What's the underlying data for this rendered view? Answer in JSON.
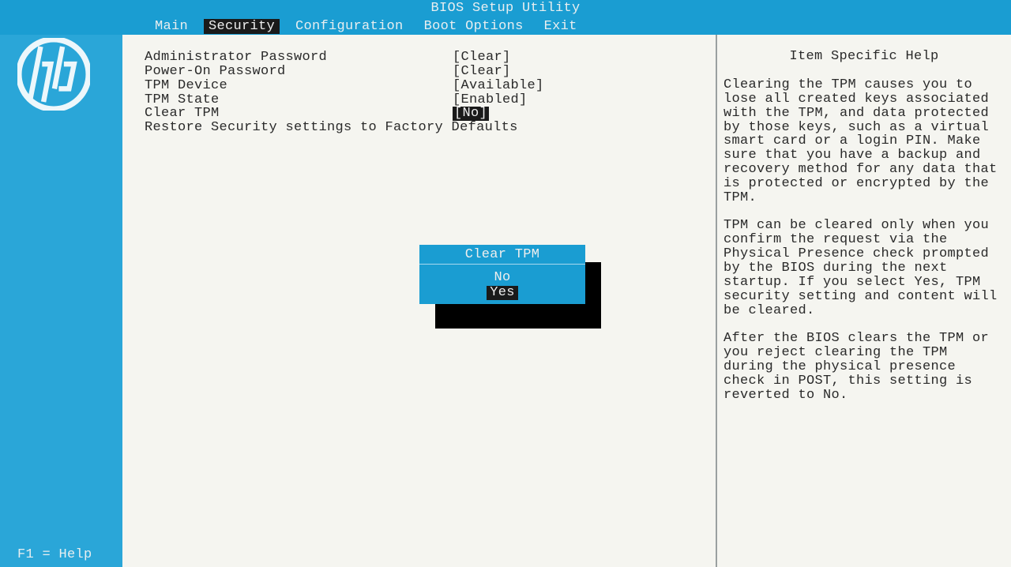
{
  "title": "BIOS Setup Utility",
  "menu": {
    "main": "Main",
    "security": "Security",
    "configuration": "Configuration",
    "boot_options": "Boot Options",
    "exit": "Exit"
  },
  "brand_text": "hp",
  "footer": "F1 = Help",
  "settings": {
    "admin_password": {
      "label": "Administrator Password",
      "value": "[Clear]"
    },
    "power_on_password": {
      "label": "Power-On Password",
      "value": "[Clear]"
    },
    "tpm_device": {
      "label": "TPM Device",
      "value": "[Available]"
    },
    "tpm_state": {
      "label": "TPM State",
      "value": "[Enabled]"
    },
    "clear_tpm": {
      "label": "Clear TPM",
      "value": "[No]"
    },
    "restore_defaults": {
      "label": "Restore Security settings to Factory Defaults"
    }
  },
  "dialog": {
    "title": "Clear TPM",
    "no": "No",
    "yes": "Yes"
  },
  "help": {
    "title": "Item Specific Help",
    "body": "Clearing the TPM causes you to lose all created keys associated with the TPM, and data protected by those keys, such as a virtual smart card or a login PIN. Make sure that you have a backup and recovery method for any data that is protected or encrypted by the TPM.\n\nTPM can be cleared only when you confirm the request via the Physical Presence check prompted by the BIOS during the next startup. If you select Yes, TPM security setting and content will be cleared.\n\nAfter the BIOS clears the TPM or you reject clearing the TPM during the physical presence check in POST, this setting is reverted to No."
  }
}
